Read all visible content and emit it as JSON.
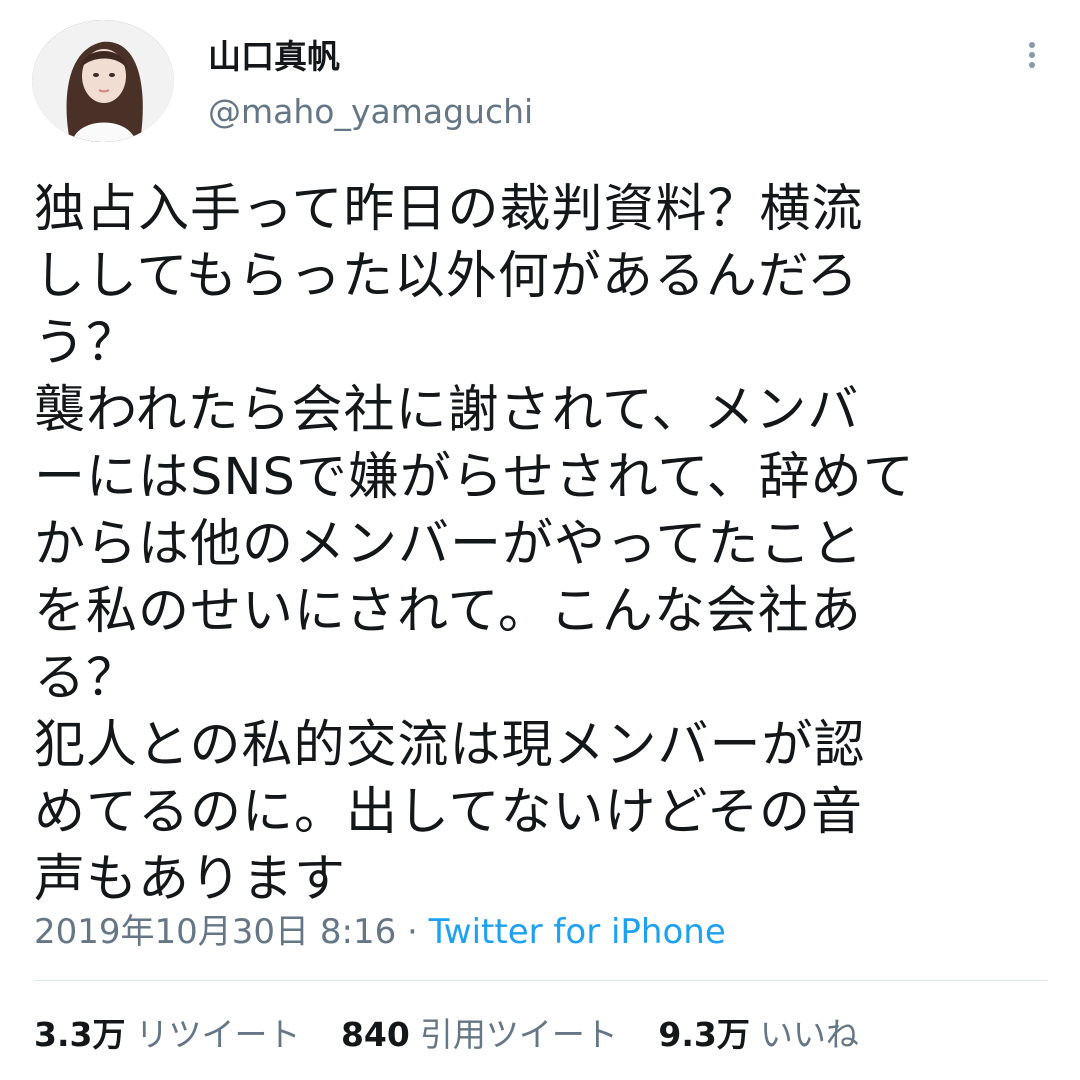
{
  "user": {
    "name": "山口真帆",
    "handle": "@maho_yamaguchi"
  },
  "tweet": {
    "lines": [
      "独占入手って昨日の裁判資料？横流",
      "ししてもらった以外何があるんだろ",
      "う？",
      "襲われたら会社に謝されて、メンバ",
      "ーにはSNSで嫌がらせされて、辞めて",
      "からは他のメンバーがやってたこと",
      "を私のせいにされて。こんな会社あ",
      "る？",
      "犯人との私的交流は現メンバーが認",
      "めてるのに。出してないけどその音",
      "声もあります"
    ]
  },
  "meta": {
    "timestamp": "2019年10月30日 8:16",
    "separator": "·",
    "source": "Twitter for iPhone"
  },
  "stats": {
    "retweets": {
      "count": "3.3万",
      "label": "リツイート"
    },
    "quotes": {
      "count": "840",
      "label": "引用ツイート"
    },
    "likes": {
      "count": "9.3万",
      "label": "いいね"
    }
  },
  "icons": {
    "more": "more-vertical-icon"
  },
  "colors": {
    "text": "#14171a",
    "secondary": "#657786",
    "link": "#1da1f2",
    "divider": "#e1e8ed"
  }
}
